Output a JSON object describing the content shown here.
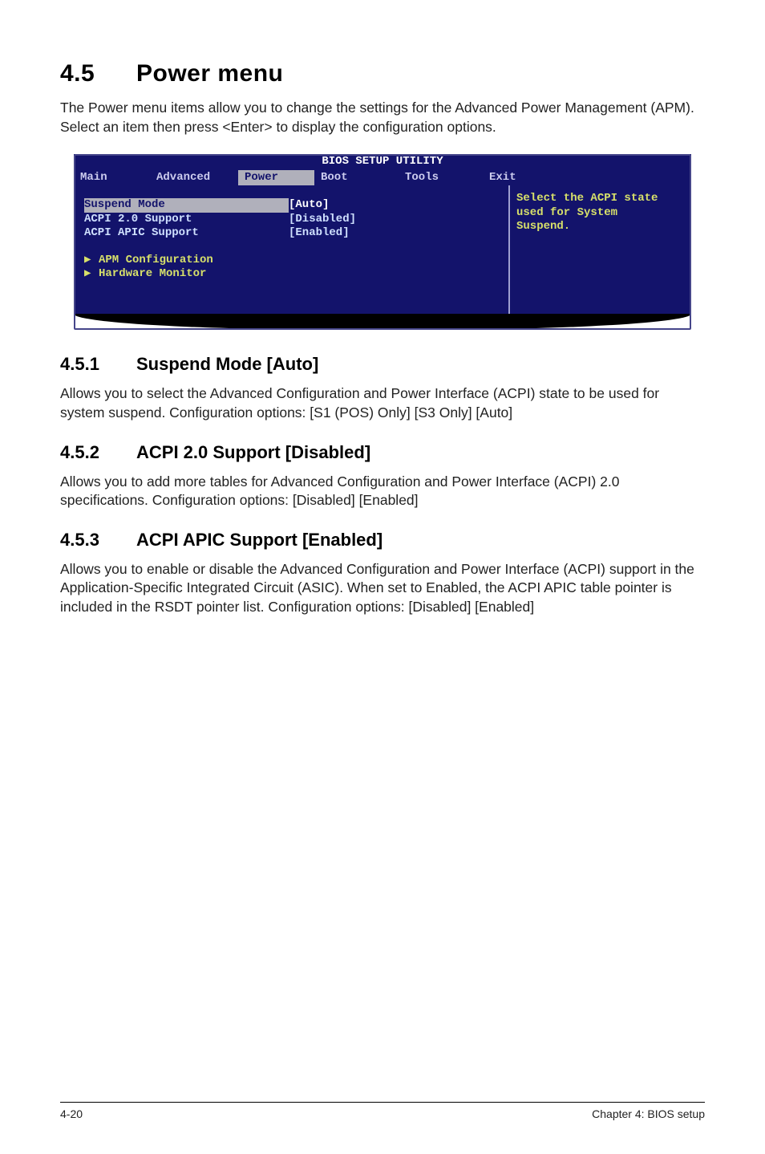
{
  "title": {
    "num": "4.5",
    "text": "Power menu"
  },
  "intro": "The Power menu items allow you to change the settings for the Advanced Power Management (APM). Select an item then press <Enter> to display the configuration options.",
  "bios": {
    "header": "BIOS SETUP UTILITY",
    "tabs": {
      "main": "Main",
      "advanced": "Advanced",
      "power": "Power",
      "boot": "Boot",
      "tools": "Tools",
      "exit": "Exit"
    },
    "rows": {
      "suspend": {
        "label": "Suspend Mode",
        "value": "[Auto]"
      },
      "acpi20": {
        "label": "ACPI 2.0 Support",
        "value": "[Disabled]"
      },
      "apic": {
        "label": "ACPI APIC Support",
        "value": "[Enabled]"
      },
      "apm": {
        "label": "APM Configuration"
      },
      "hw": {
        "label": "Hardware Monitor"
      }
    },
    "help": {
      "l1": "Select the ACPI state",
      "l2": "used for System",
      "l3": "Suspend."
    }
  },
  "sections": {
    "s451": {
      "num": "4.5.1",
      "title": "Suspend Mode [Auto]",
      "body": "Allows you to select the Advanced Configuration and Power Interface (ACPI) state to be used for system suspend. Configuration options: [S1 (POS) Only] [S3 Only] [Auto]"
    },
    "s452": {
      "num": "4.5.2",
      "title": "ACPI 2.0 Support [Disabled]",
      "body": "Allows you to add more tables for Advanced Configuration and Power Interface (ACPI) 2.0 specifications. Configuration options: [Disabled] [Enabled]"
    },
    "s453": {
      "num": "4.5.3",
      "title": "ACPI APIC Support [Enabled]",
      "body": "Allows you to enable or disable the Advanced Configuration and Power Interface (ACPI) support in the Application-Specific Integrated Circuit (ASIC). When set to Enabled, the ACPI APIC table pointer is included in the RSDT pointer list. Configuration options: [Disabled] [Enabled]"
    }
  },
  "footer": {
    "left": "4-20",
    "right": "Chapter 4: BIOS setup"
  }
}
